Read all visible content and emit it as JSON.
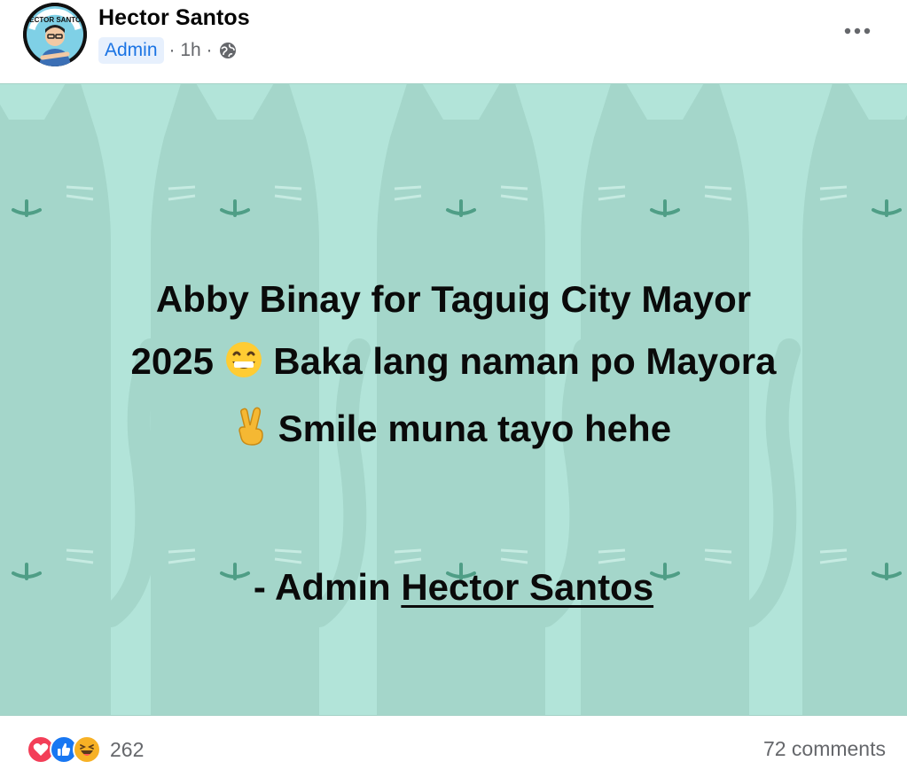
{
  "post": {
    "author": "Hector Santos",
    "role": "Admin",
    "time": "· 1h ·",
    "audience_icon": "globe-icon",
    "more_icon": "more-horizontal-icon"
  },
  "card": {
    "background_color": "#b2e4d9",
    "line1": "Abby Binay for Taguig City Mayor",
    "line2_a": "2025",
    "line2_emoji": "grinning-face-emoji",
    "line2_b": "Baka lang naman po Mayora",
    "line3_emoji": "victory-hand-emoji",
    "line3": "Smile muna tayo hehe",
    "sign_prefix": "- Admin",
    "sign_name": "Hector Santos"
  },
  "footer": {
    "reaction_icons": [
      "love-icon",
      "like-icon",
      "haha-icon"
    ],
    "reaction_count": "262",
    "comments": "72 comments"
  },
  "colors": {
    "accent_blue": "#1b74e4",
    "love_red": "#f33e58",
    "like_blue": "#1877f2",
    "haha_yellow": "#f7b125"
  }
}
